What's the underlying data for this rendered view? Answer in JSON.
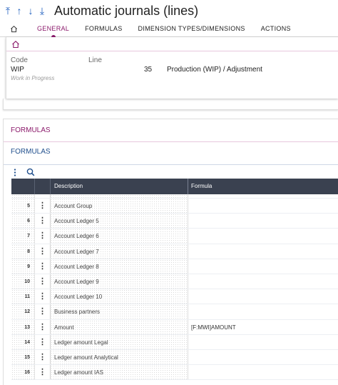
{
  "header": {
    "title": "Automatic journals (lines)",
    "nav_icons": [
      "arrow-first-icon",
      "arrow-up-icon",
      "arrow-down-icon",
      "arrow-last-icon"
    ],
    "nav_glyphs": [
      "⤒",
      "↑",
      "↓",
      "⤓"
    ]
  },
  "tabs": [
    {
      "label": "GENERAL",
      "active": true
    },
    {
      "label": "FORMULAS",
      "active": false
    },
    {
      "label": "DIMENSION TYPES/DIMENSIONS",
      "active": false
    },
    {
      "label": "ACTIONS",
      "active": false
    }
  ],
  "record": {
    "code_label": "Code",
    "code_value": "WIP",
    "code_sub": "Work in Progress",
    "line_label": "Line",
    "line_value": "35",
    "line_desc": "Production (WIP) / Adjustment"
  },
  "section": {
    "title": "FORMULAS",
    "block_title": "FORMULAS"
  },
  "grid": {
    "col_description": "Description",
    "col_formula": "Formula",
    "rows": [
      {
        "num": "5",
        "description": "Account Group",
        "formula": ""
      },
      {
        "num": "6",
        "description": "Account Ledger 5",
        "formula": ""
      },
      {
        "num": "7",
        "description": "Account Ledger 6",
        "formula": ""
      },
      {
        "num": "8",
        "description": "Account Ledger 7",
        "formula": ""
      },
      {
        "num": "9",
        "description": "Account Ledger 8",
        "formula": ""
      },
      {
        "num": "10",
        "description": "Account Ledger 9",
        "formula": ""
      },
      {
        "num": "11",
        "description": "Account Ledger 10",
        "formula": ""
      },
      {
        "num": "12",
        "description": "Business partners",
        "formula": ""
      },
      {
        "num": "13",
        "description": "Amount",
        "formula": "[F:MWI]AMOUNT"
      },
      {
        "num": "14",
        "description": "Ledger amount Legal",
        "formula": ""
      },
      {
        "num": "15",
        "description": "Ledger amount Analytical",
        "formula": ""
      },
      {
        "num": "16",
        "description": "Ledger amount IAS",
        "formula": ""
      }
    ]
  },
  "colors": {
    "accent": "#8b1a6b",
    "link_blue": "#1f5fbf",
    "grid_header": "#3a4150"
  }
}
